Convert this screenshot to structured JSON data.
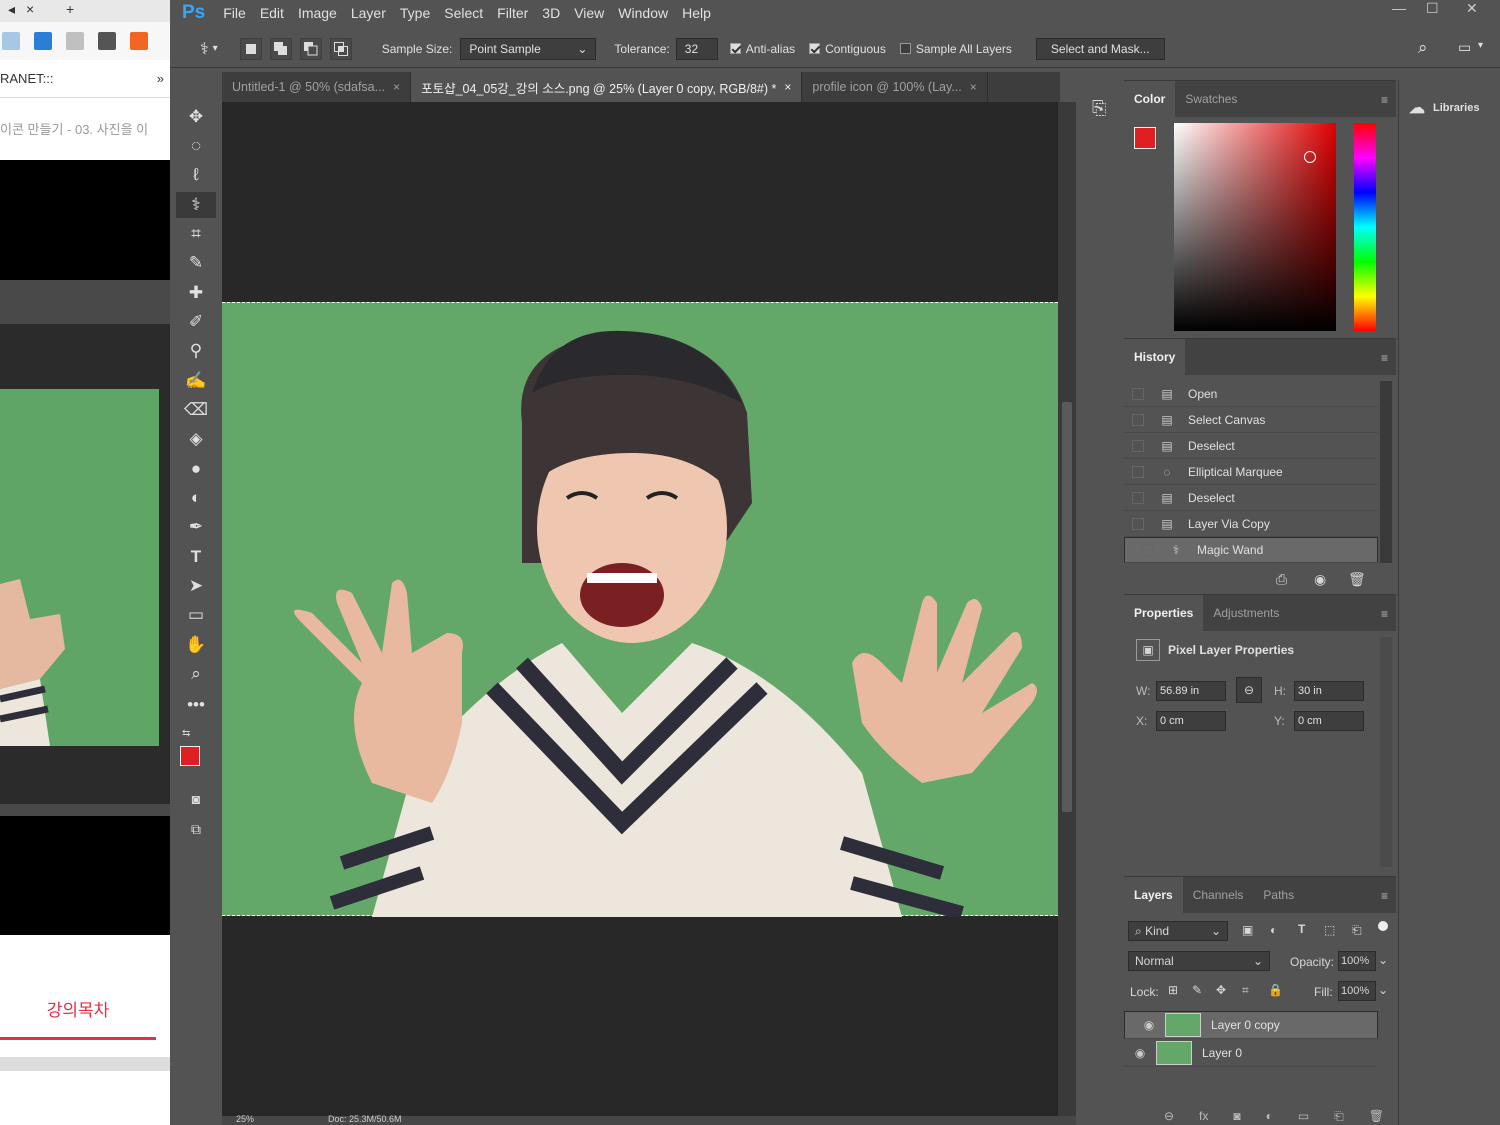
{
  "browser": {
    "tab_close": "×",
    "tab_new": "+",
    "addr_text": "RANET:::",
    "addr_more": "»",
    "crumb": "이콘 만들기 - 03. 사진을 이",
    "toc": "강의목차"
  },
  "menu": {
    "logo": "Ps",
    "items": [
      "File",
      "Edit",
      "Image",
      "Layer",
      "Type",
      "Select",
      "Filter",
      "3D",
      "View",
      "Window",
      "Help"
    ]
  },
  "options": {
    "sample_size_label": "Sample Size:",
    "sample_size_value": "Point Sample",
    "tolerance_label": "Tolerance:",
    "tolerance_value": "32",
    "antialias": "Anti-alias",
    "contiguous": "Contiguous",
    "sample_all": "Sample All Layers",
    "select_mask": "Select and Mask..."
  },
  "tabs": [
    {
      "label": "Untitled-1 @ 50% (sdafsa...",
      "close": "×"
    },
    {
      "label": "포토샵_04_05강_강의 소스.png @ 25% (Layer 0 copy, RGB/8#) *",
      "close": "×"
    },
    {
      "label": "profile icon @ 100% (Lay...",
      "close": "×"
    }
  ],
  "color_panel": {
    "tab1": "Color",
    "tab2": "Swatches",
    "fg": "#e02020"
  },
  "history": {
    "title": "History",
    "items": [
      "Open",
      "Select Canvas",
      "Deselect",
      "Elliptical Marquee",
      "Deselect",
      "Layer Via Copy",
      "Magic Wand"
    ]
  },
  "properties": {
    "tab1": "Properties",
    "tab2": "Adjustments",
    "header": "Pixel Layer Properties",
    "w_label": "W:",
    "w_value": "56.89 in",
    "h_label": "H:",
    "h_value": "30 in",
    "x_label": "X:",
    "x_value": "0 cm",
    "y_label": "Y:",
    "y_value": "0 cm"
  },
  "layers": {
    "tab1": "Layers",
    "tab2": "Channels",
    "tab3": "Paths",
    "kind": "Kind",
    "blend": "Normal",
    "opacity_label": "Opacity:",
    "opacity_value": "100%",
    "lock_label": "Lock:",
    "fill_label": "Fill:",
    "fill_value": "100%",
    "rows": [
      "Layer 0 copy",
      "Layer 0"
    ]
  },
  "libraries": {
    "label": "Libraries"
  },
  "status": {
    "zoom": "25%",
    "doc": "Doc: 25.3M/50.6M"
  }
}
